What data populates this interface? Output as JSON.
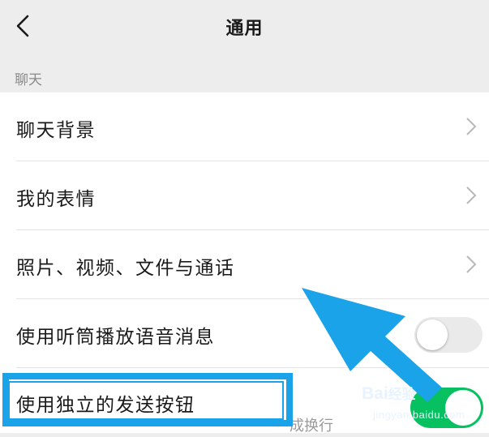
{
  "header": {
    "title": "通用",
    "back_icon": "chevron-left-icon"
  },
  "section": {
    "label": "聊天"
  },
  "rows": [
    {
      "label": "聊天背景",
      "control": "chevron-right-icon"
    },
    {
      "label": "我的表情",
      "control": "chevron-right-icon"
    },
    {
      "label": "照片、视频、文件与通话",
      "control": "chevron-right-icon"
    },
    {
      "label": "使用听筒播放语音消息",
      "control": "toggle",
      "on": false
    },
    {
      "label": "使用独立的发送按钮",
      "control": "toggle",
      "on": true,
      "subtext": "成换行"
    }
  ],
  "annotation": {
    "arrow_color": "#1aa3e8",
    "box_color": "#1aa3e8"
  },
  "watermark": {
    "brand": "Bai",
    "brand_cn": "经验",
    "url": "jingyan.baidu.com"
  },
  "colors": {
    "toggle_on": "#07c160",
    "background": "#ededed"
  }
}
